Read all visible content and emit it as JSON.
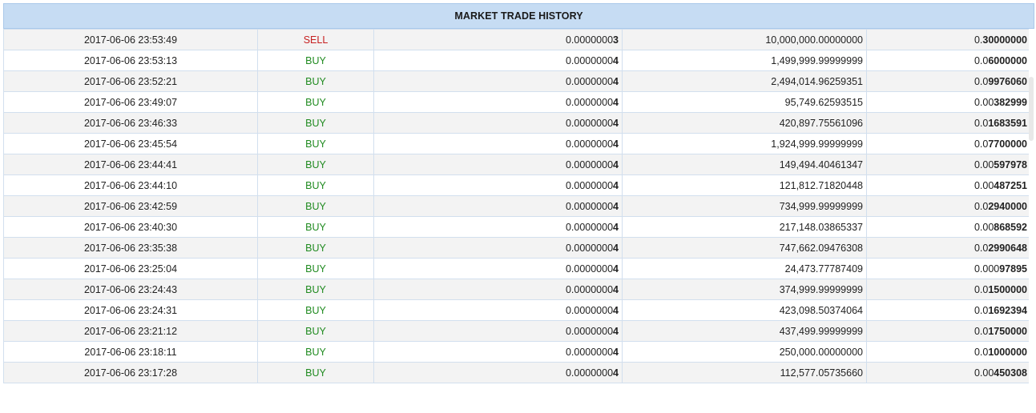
{
  "title": "MARKET TRADE HISTORY",
  "colors": {
    "header_bg": "#c6dcf3",
    "sell": "#c62020",
    "buy": "#1f8a1f"
  },
  "trades": [
    {
      "date": "2017-06-06 23:53:49",
      "type": "SELL",
      "price": {
        "light": "0.0000000",
        "bold": "3"
      },
      "amount": "10,000,000.00000000",
      "total": {
        "light": "0.",
        "bold": "30000000"
      }
    },
    {
      "date": "2017-06-06 23:53:13",
      "type": "BUY",
      "price": {
        "light": "0.0000000",
        "bold": "4"
      },
      "amount": "1,499,999.99999999",
      "total": {
        "light": "0.0",
        "bold": "6000000"
      }
    },
    {
      "date": "2017-06-06 23:52:21",
      "type": "BUY",
      "price": {
        "light": "0.0000000",
        "bold": "4"
      },
      "amount": "2,494,014.96259351",
      "total": {
        "light": "0.0",
        "bold": "9976060"
      }
    },
    {
      "date": "2017-06-06 23:49:07",
      "type": "BUY",
      "price": {
        "light": "0.0000000",
        "bold": "4"
      },
      "amount": "95,749.62593515",
      "total": {
        "light": "0.00",
        "bold": "382999"
      }
    },
    {
      "date": "2017-06-06 23:46:33",
      "type": "BUY",
      "price": {
        "light": "0.0000000",
        "bold": "4"
      },
      "amount": "420,897.75561096",
      "total": {
        "light": "0.0",
        "bold": "1683591"
      }
    },
    {
      "date": "2017-06-06 23:45:54",
      "type": "BUY",
      "price": {
        "light": "0.0000000",
        "bold": "4"
      },
      "amount": "1,924,999.99999999",
      "total": {
        "light": "0.0",
        "bold": "7700000"
      }
    },
    {
      "date": "2017-06-06 23:44:41",
      "type": "BUY",
      "price": {
        "light": "0.0000000",
        "bold": "4"
      },
      "amount": "149,494.40461347",
      "total": {
        "light": "0.00",
        "bold": "597978"
      }
    },
    {
      "date": "2017-06-06 23:44:10",
      "type": "BUY",
      "price": {
        "light": "0.0000000",
        "bold": "4"
      },
      "amount": "121,812.71820448",
      "total": {
        "light": "0.00",
        "bold": "487251"
      }
    },
    {
      "date": "2017-06-06 23:42:59",
      "type": "BUY",
      "price": {
        "light": "0.0000000",
        "bold": "4"
      },
      "amount": "734,999.99999999",
      "total": {
        "light": "0.0",
        "bold": "2940000"
      }
    },
    {
      "date": "2017-06-06 23:40:30",
      "type": "BUY",
      "price": {
        "light": "0.0000000",
        "bold": "4"
      },
      "amount": "217,148.03865337",
      "total": {
        "light": "0.00",
        "bold": "868592"
      }
    },
    {
      "date": "2017-06-06 23:35:38",
      "type": "BUY",
      "price": {
        "light": "0.0000000",
        "bold": "4"
      },
      "amount": "747,662.09476308",
      "total": {
        "light": "0.0",
        "bold": "2990648"
      }
    },
    {
      "date": "2017-06-06 23:25:04",
      "type": "BUY",
      "price": {
        "light": "0.0000000",
        "bold": "4"
      },
      "amount": "24,473.77787409",
      "total": {
        "light": "0.000",
        "bold": "97895"
      }
    },
    {
      "date": "2017-06-06 23:24:43",
      "type": "BUY",
      "price": {
        "light": "0.0000000",
        "bold": "4"
      },
      "amount": "374,999.99999999",
      "total": {
        "light": "0.0",
        "bold": "1500000"
      }
    },
    {
      "date": "2017-06-06 23:24:31",
      "type": "BUY",
      "price": {
        "light": "0.0000000",
        "bold": "4"
      },
      "amount": "423,098.50374064",
      "total": {
        "light": "0.0",
        "bold": "1692394"
      }
    },
    {
      "date": "2017-06-06 23:21:12",
      "type": "BUY",
      "price": {
        "light": "0.0000000",
        "bold": "4"
      },
      "amount": "437,499.99999999",
      "total": {
        "light": "0.0",
        "bold": "1750000"
      }
    },
    {
      "date": "2017-06-06 23:18:11",
      "type": "BUY",
      "price": {
        "light": "0.0000000",
        "bold": "4"
      },
      "amount": "250,000.00000000",
      "total": {
        "light": "0.0",
        "bold": "1000000"
      }
    },
    {
      "date": "2017-06-06 23:17:28",
      "type": "BUY",
      "price": {
        "light": "0.0000000",
        "bold": "4"
      },
      "amount": "112,577.05735660",
      "total": {
        "light": "0.00",
        "bold": "450308"
      }
    }
  ]
}
